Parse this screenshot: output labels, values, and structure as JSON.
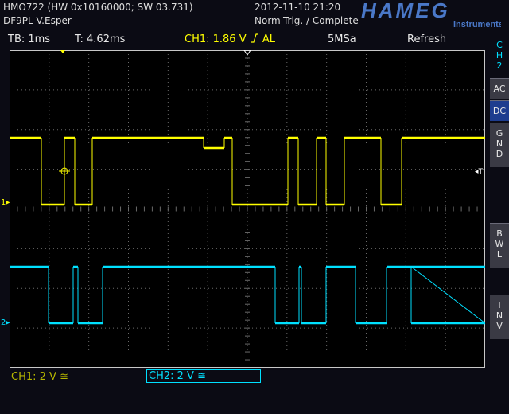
{
  "header": {
    "model_line": "HMO722 (HW 0x10160000; SW 03.731)",
    "user_line": "DF9PL V.Esper",
    "datetime": "2012-11-10 21:20",
    "trigger_status": "Norm-Trig. / Complete",
    "brand": "HAMEG",
    "brand_sub": "Instruments"
  },
  "statusbar": {
    "timebase": "TB: 1ms",
    "trigger_time": "T: 4.62ms",
    "trigger_level": "CH1: 1.86 V",
    "trigger_slope_icon": "rising-edge-icon",
    "trigger_coupling": "AL",
    "sample_rate": "5MSa",
    "mode": "Refresh"
  },
  "side_menu": {
    "channel_title": [
      "C",
      "H",
      "2"
    ],
    "ac_label": "AC",
    "dc_label": "DC",
    "gnd_label": [
      "G",
      "N",
      "D"
    ],
    "bwl_label": [
      "B",
      "W",
      "L"
    ],
    "inv_label": [
      "I",
      "N",
      "V"
    ],
    "selected": "DC"
  },
  "channels": {
    "ch1": {
      "label": "CH1: 2 V",
      "coupling_icon": "dc-coupling-icon",
      "color": "#ffff00",
      "marker": "1"
    },
    "ch2": {
      "label": "CH2: 2 V",
      "coupling_icon": "dc-coupling-icon",
      "color": "#00e0ff",
      "marker": "2",
      "active": true
    }
  },
  "markers": {
    "trigger_right": "T"
  },
  "colors": {
    "ch1": "#ffff00",
    "ch2": "#00e0ff",
    "grid": "#6a6a6a",
    "frame": "#c8c8c8",
    "selected_button": "#1e3d8f"
  }
}
